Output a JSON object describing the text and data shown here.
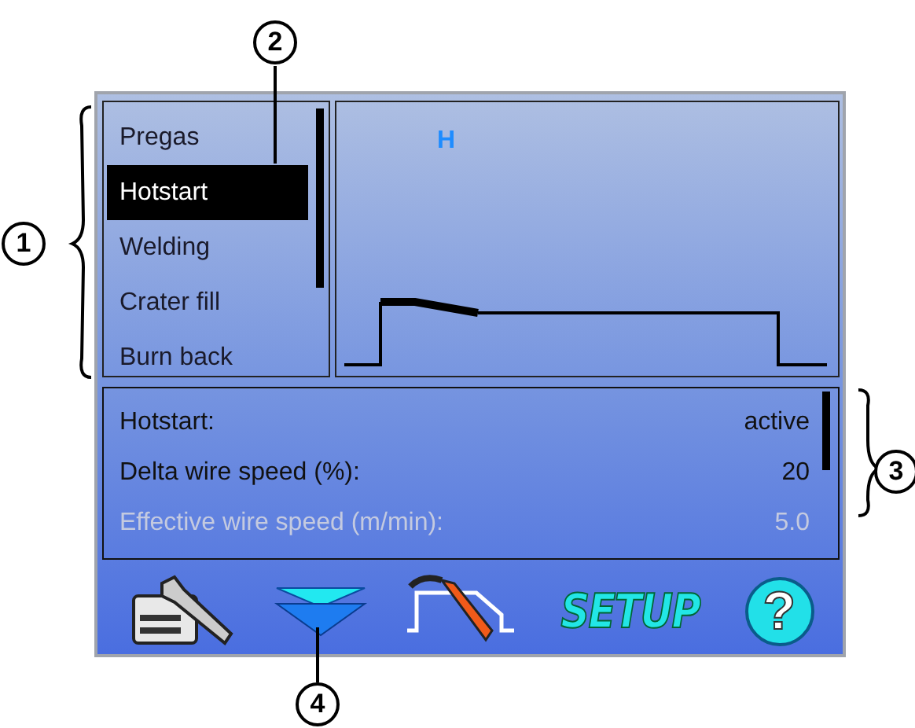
{
  "phases": [
    {
      "label": "Pregas",
      "selected": false
    },
    {
      "label": "Hotstart",
      "selected": true
    },
    {
      "label": "Welding",
      "selected": false
    },
    {
      "label": "Crater fill",
      "selected": false
    },
    {
      "label": "Burn back",
      "selected": false
    }
  ],
  "graph": {
    "marker": "H"
  },
  "parameters": [
    {
      "name": "Hotstart:",
      "value": "active",
      "disabled": false
    },
    {
      "name": "Delta wire speed (%):",
      "value": "20",
      "disabled": false
    },
    {
      "name": "Effective wire speed (m/min):",
      "value": "5.0",
      "disabled": true
    }
  ],
  "toolbar": [
    {
      "kind": "tools"
    },
    {
      "kind": "down"
    },
    {
      "kind": "torch"
    },
    {
      "kind": "text",
      "label": "SETUP"
    },
    {
      "kind": "help",
      "label": "?"
    }
  ],
  "callouts": [
    {
      "label": "1"
    },
    {
      "label": "2"
    },
    {
      "label": "3"
    },
    {
      "label": "4"
    }
  ]
}
